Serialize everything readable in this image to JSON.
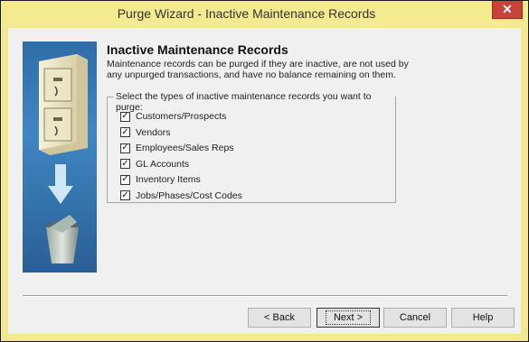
{
  "window": {
    "title": "Purge Wizard - Inactive Maintenance Records",
    "close_glyph": "✕"
  },
  "page": {
    "heading": "Inactive Maintenance Records",
    "description": "Maintenance records can be purged if they are inactive, are not used by any unpurged transactions, and have no balance remaining on them.",
    "group_label": "Select the types of inactive maintenance records you want to purge:"
  },
  "checkboxes": [
    {
      "label": "Customers/Prospects",
      "checked": true
    },
    {
      "label": "Vendors",
      "checked": true
    },
    {
      "label": "Employees/Sales Reps",
      "checked": true
    },
    {
      "label": "GL Accounts",
      "checked": true
    },
    {
      "label": "Inventory Items",
      "checked": true
    },
    {
      "label": "Jobs/Phases/Cost Codes",
      "checked": true
    }
  ],
  "buttons": {
    "back": "< Back",
    "next": "Next >",
    "cancel": "Cancel",
    "help": "Help"
  },
  "colors": {
    "titlebar": "#f4ea8f",
    "close": "#c7433a",
    "client": "#f0f0f0",
    "art_blue": "#3f86c4"
  }
}
